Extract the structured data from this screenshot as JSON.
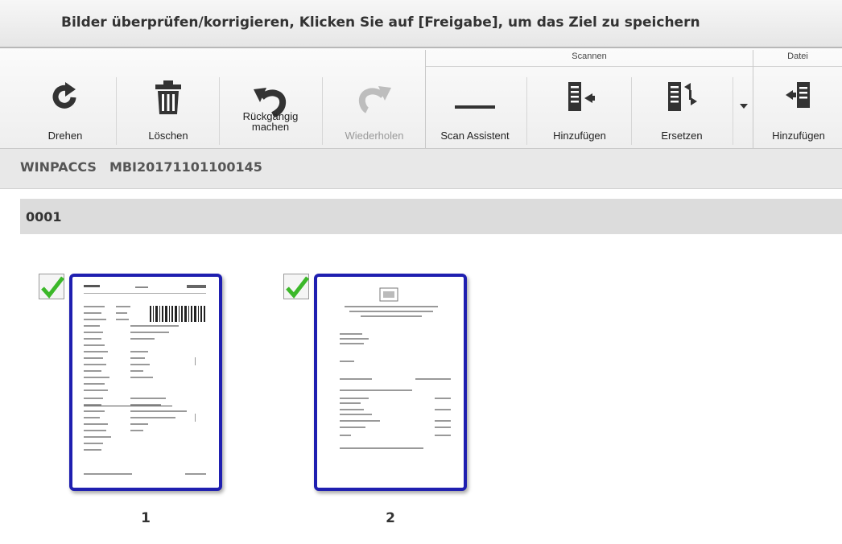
{
  "title": "Bilder überprüfen/korrigieren, Klicken Sie auf [Freigabe], um das Ziel zu speichern",
  "ribbon": {
    "groups": {
      "scannen": "Scannen",
      "datei": "Datei"
    },
    "buttons": {
      "drehen": "Drehen",
      "loeschen": "Löschen",
      "rueckgaengig_line1": "Rückgängig",
      "rueckgaengig_line2": "machen",
      "wiederholen": "Wiederholen",
      "scan_assistent": "Scan Assistent",
      "hinzufuegen_scan": "Hinzufügen",
      "ersetzen": "Ersetzen",
      "hinzufuegen_datei": "Hinzufügen"
    }
  },
  "batch": {
    "app": "WINPACCS",
    "id": "MBI20171101100145"
  },
  "section": {
    "label": "0001"
  },
  "pages": [
    {
      "number": "1",
      "checked": true
    },
    {
      "number": "2",
      "checked": true
    }
  ],
  "colors": {
    "selection_border": "#1f1fb0",
    "check": "#3cb82a",
    "disabled": "#999999"
  }
}
